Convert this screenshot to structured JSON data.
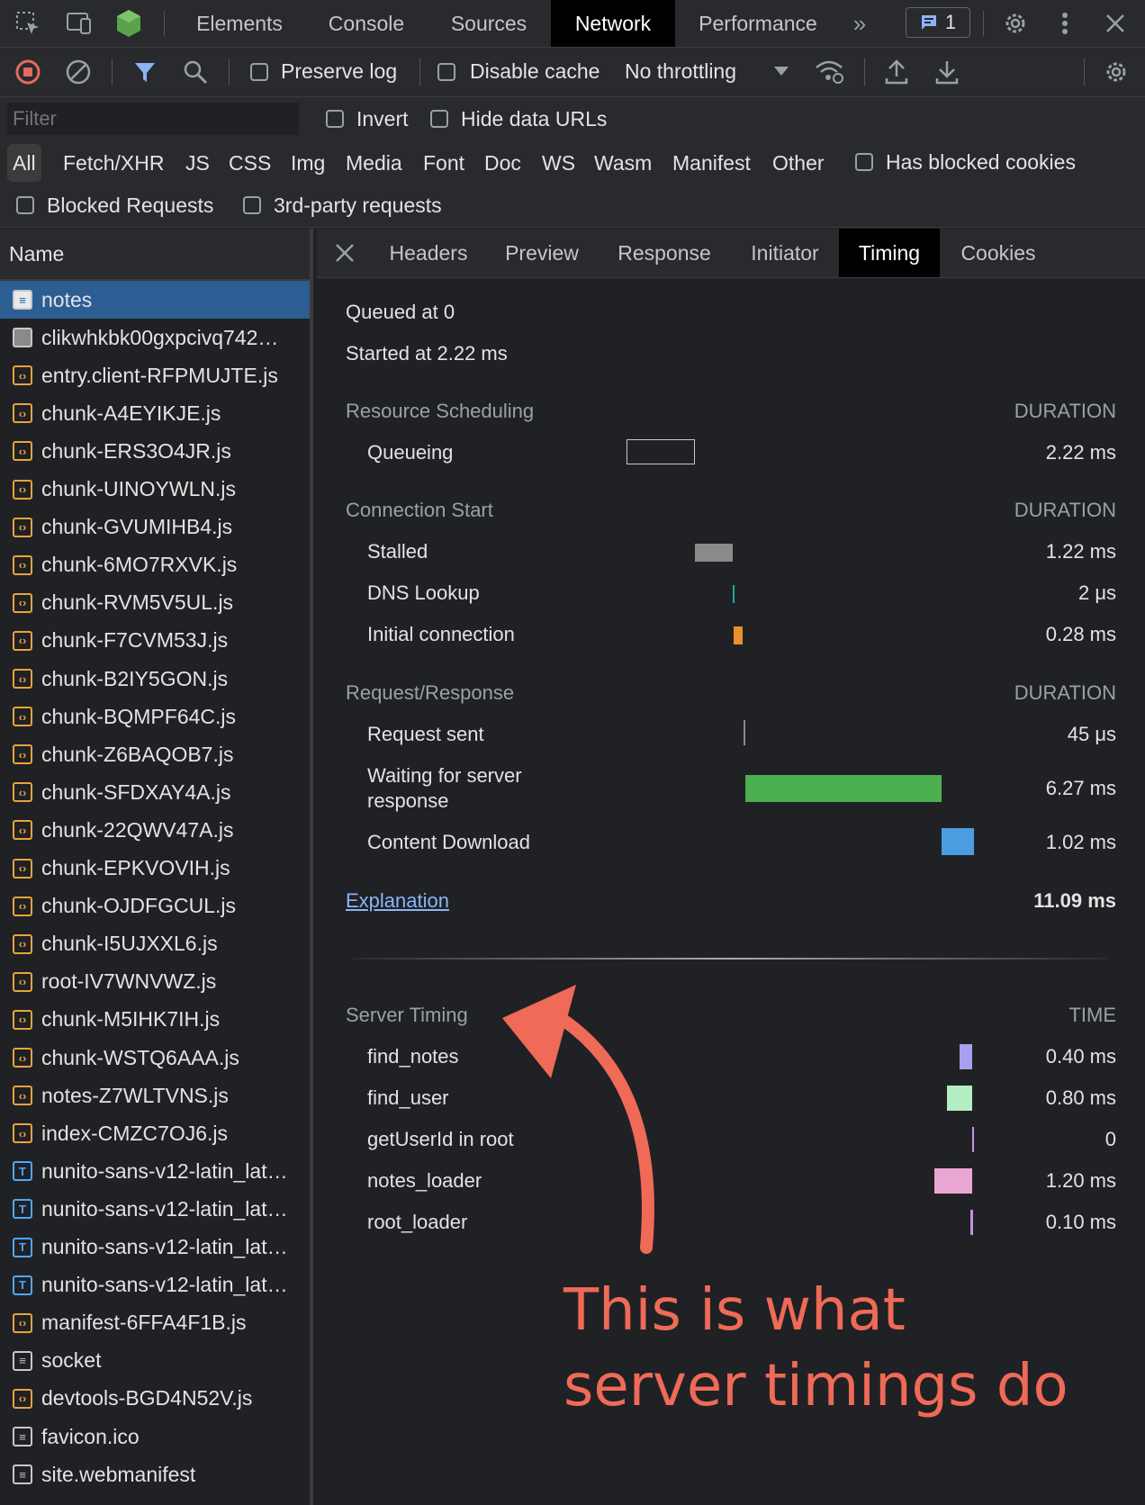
{
  "toolbar": {
    "tabs": [
      "Elements",
      "Console",
      "Sources",
      "Network",
      "Performance"
    ],
    "issues_count": "1"
  },
  "network_toolbar": {
    "preserve_log": "Preserve log",
    "disable_cache": "Disable cache",
    "throttling": "No throttling"
  },
  "filter": {
    "placeholder": "Filter",
    "invert": "Invert",
    "hide_data_urls": "Hide data URLs",
    "types": [
      "All",
      "Fetch/XHR",
      "JS",
      "CSS",
      "Img",
      "Media",
      "Font",
      "Doc",
      "WS",
      "Wasm",
      "Manifest",
      "Other"
    ],
    "has_blocked_cookies": "Has blocked cookies",
    "blocked_requests": "Blocked Requests",
    "third_party": "3rd-party requests"
  },
  "requests": {
    "header": "Name",
    "items": [
      {
        "name": "notes",
        "kind": "doc"
      },
      {
        "name": "clikwhkbk00gxpcivq742…",
        "kind": "img"
      },
      {
        "name": "entry.client-RFPMUJTE.js",
        "kind": "script"
      },
      {
        "name": "chunk-A4EYIKJE.js",
        "kind": "script"
      },
      {
        "name": "chunk-ERS3O4JR.js",
        "kind": "script"
      },
      {
        "name": "chunk-UINOYWLN.js",
        "kind": "script"
      },
      {
        "name": "chunk-GVUMIHB4.js",
        "kind": "script"
      },
      {
        "name": "chunk-6MO7RXVK.js",
        "kind": "script"
      },
      {
        "name": "chunk-RVM5V5UL.js",
        "kind": "script"
      },
      {
        "name": "chunk-F7CVM53J.js",
        "kind": "script"
      },
      {
        "name": "chunk-B2IY5GON.js",
        "kind": "script"
      },
      {
        "name": "chunk-BQMPF64C.js",
        "kind": "script"
      },
      {
        "name": "chunk-Z6BAQOB7.js",
        "kind": "script"
      },
      {
        "name": "chunk-SFDXAY4A.js",
        "kind": "script"
      },
      {
        "name": "chunk-22QWV47A.js",
        "kind": "script"
      },
      {
        "name": "chunk-EPKVOVIH.js",
        "kind": "script"
      },
      {
        "name": "chunk-OJDFGCUL.js",
        "kind": "script"
      },
      {
        "name": "chunk-I5UJXXL6.js",
        "kind": "script"
      },
      {
        "name": "root-IV7WNVWZ.js",
        "kind": "script"
      },
      {
        "name": "chunk-M5IHK7IH.js",
        "kind": "script"
      },
      {
        "name": "chunk-WSTQ6AAA.js",
        "kind": "script"
      },
      {
        "name": "notes-Z7WLTVNS.js",
        "kind": "script"
      },
      {
        "name": "index-CMZC7OJ6.js",
        "kind": "script"
      },
      {
        "name": "nunito-sans-v12-latin_lat…",
        "kind": "font"
      },
      {
        "name": "nunito-sans-v12-latin_lat…",
        "kind": "font"
      },
      {
        "name": "nunito-sans-v12-latin_lat…",
        "kind": "font"
      },
      {
        "name": "nunito-sans-v12-latin_lat…",
        "kind": "font"
      },
      {
        "name": "manifest-6FFA4F1B.js",
        "kind": "script"
      },
      {
        "name": "socket",
        "kind": "doc"
      },
      {
        "name": "devtools-BGD4N52V.js",
        "kind": "script"
      },
      {
        "name": "favicon.ico",
        "kind": "doc"
      },
      {
        "name": "site.webmanifest",
        "kind": "doc"
      }
    ]
  },
  "details": {
    "tabs": [
      "Headers",
      "Preview",
      "Response",
      "Initiator",
      "Timing",
      "Cookies"
    ],
    "queued": "Queued at 0",
    "started": "Started at 2.22 ms",
    "duration_label": "DURATION",
    "time_label": "TIME",
    "sections": {
      "resource_scheduling": "Resource Scheduling",
      "connection_start": "Connection Start",
      "request_response": "Request/Response",
      "server_timing": "Server Timing"
    },
    "timing": {
      "queueing": {
        "label": "Queueing",
        "value": "2.22 ms"
      },
      "stalled": {
        "label": "Stalled",
        "value": "1.22 ms"
      },
      "dns": {
        "label": "DNS Lookup",
        "value": "2 μs"
      },
      "initial": {
        "label": "Initial connection",
        "value": "0.28 ms"
      },
      "request_sent": {
        "label": "Request sent",
        "value": "45 μs"
      },
      "waiting": {
        "label": "Waiting for server response",
        "value": "6.27 ms"
      },
      "download": {
        "label": "Content Download",
        "value": "1.02 ms"
      }
    },
    "explanation": "Explanation",
    "total": "11.09 ms",
    "server": [
      {
        "label": "find_notes",
        "value": "0.40 ms"
      },
      {
        "label": "find_user",
        "value": "0.80 ms"
      },
      {
        "label": "getUserId in root",
        "value": "0"
      },
      {
        "label": "notes_loader",
        "value": "1.20 ms"
      },
      {
        "label": "root_loader",
        "value": "0.10 ms"
      }
    ]
  },
  "annotation": {
    "line1": "This is what",
    "line2": "server timings do",
    "color": "#ef6a57"
  }
}
